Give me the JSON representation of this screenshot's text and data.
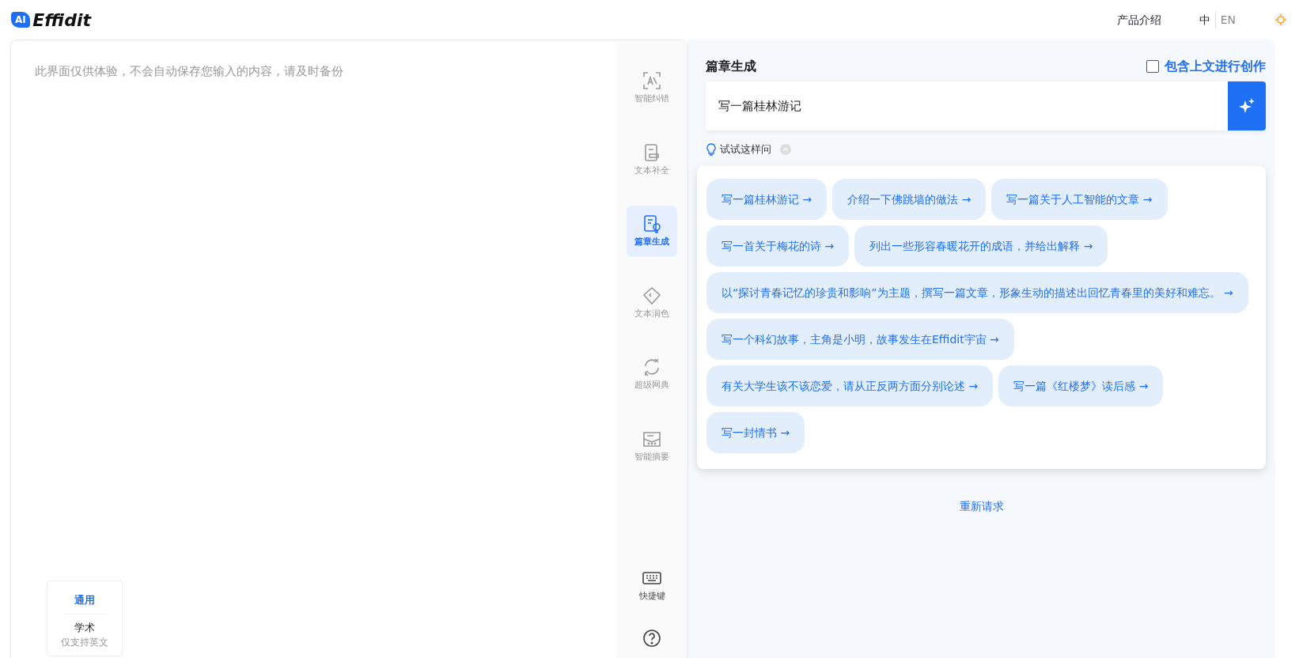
{
  "header": {
    "logo_badge": "AI",
    "logo_text": "Effidit",
    "nav_link": "产品介绍",
    "languages": [
      {
        "label": "中",
        "selected": true
      },
      {
        "label": "EN",
        "selected": false
      }
    ]
  },
  "editor": {
    "placeholder": "此界面仅供体验，不会自动保存您输入的内容，请及时备份",
    "modes": [
      {
        "label": "通用",
        "selected": true
      },
      {
        "label": "学术",
        "note": "仅支持英文",
        "selected": false
      }
    ]
  },
  "tools": [
    {
      "kind": "correction",
      "label": "智能纠错",
      "selected": false
    },
    {
      "kind": "completion",
      "label": "文本补全",
      "selected": false
    },
    {
      "kind": "generation",
      "label": "篇章生成",
      "selected": true
    },
    {
      "kind": "polish",
      "label": "文本润色",
      "selected": false
    },
    {
      "kind": "dictionary",
      "label": "超级网典",
      "selected": false
    },
    {
      "kind": "summary",
      "label": "智能摘要",
      "selected": false
    },
    {
      "kind": "shortcut",
      "label": "快捷键",
      "selected": false
    },
    {
      "kind": "help",
      "selected": false
    }
  ],
  "panel": {
    "title": "篇章生成",
    "context_option": {
      "label": "包含上文进行创作",
      "checked": false
    },
    "prompt": "写一篇桂林游记",
    "hint": "试试这样问",
    "retry": "重新请求",
    "suggestions": [
      "写一篇桂林游记 →",
      "介绍一下佛跳墙的做法 →",
      "写一篇关于人工智能的文章 →",
      "写一首关于梅花的诗 →",
      "列出一些形容春暖花开的成语，并给出解释 →",
      "以“探讨青春记忆的珍贵和影响”为主题，撰写一篇文章，形象生动的描述出回忆青春里的美好和难忘。 →",
      "写一个科幻故事，主角是小明，故事发生在Effidit宇宙 →",
      "有关大学生该不该恋爱，请从正反两方面分别论述 →",
      "写一篇《红楼梦》读后感 →",
      "写一封情书 →"
    ]
  }
}
